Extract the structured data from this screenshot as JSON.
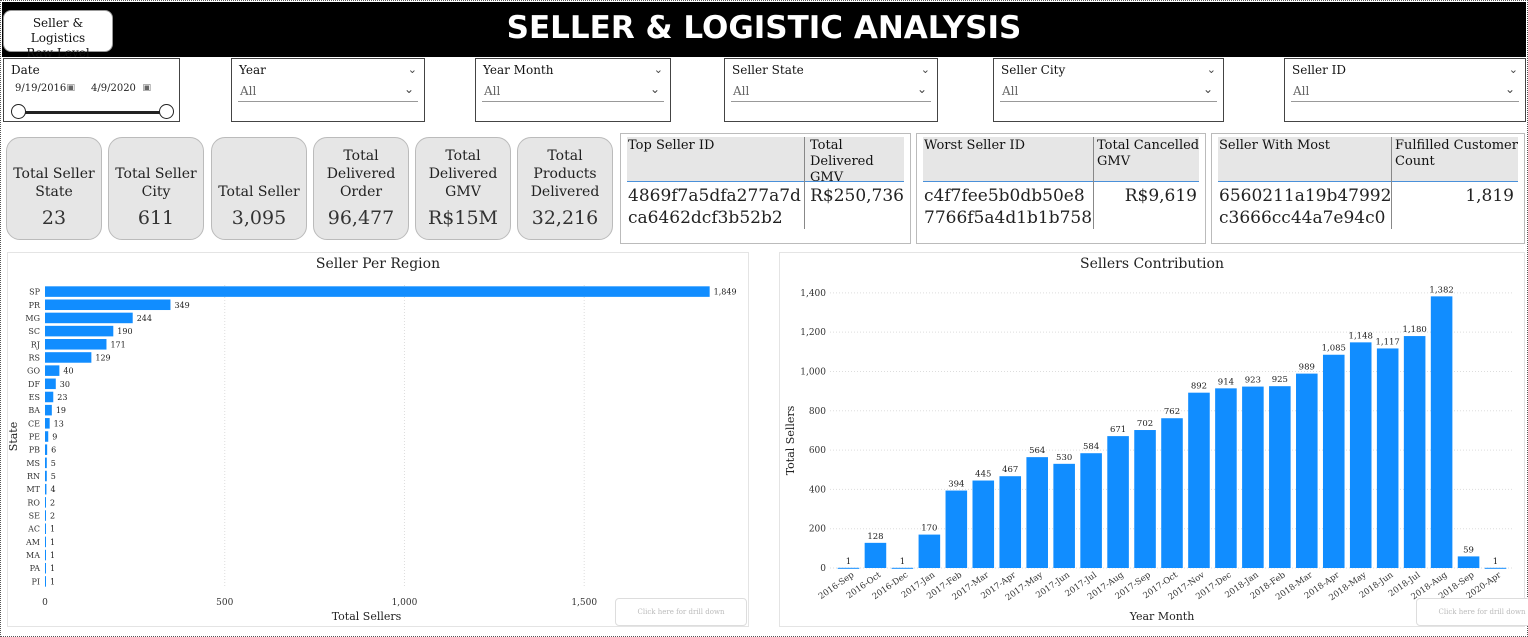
{
  "header": {
    "title": "SELLER & LOGISTIC ANALYSIS",
    "nav_button_line1": "Seller & Logistics",
    "nav_button_line2": "Raw Level"
  },
  "filters": {
    "date": {
      "label": "Date",
      "start": "9/19/2016",
      "end": "4/9/2020"
    },
    "year": {
      "label": "Year",
      "value": "All"
    },
    "year_month": {
      "label": "Year Month",
      "value": "All"
    },
    "seller_state": {
      "label": "Seller State",
      "value": "All"
    },
    "seller_city": {
      "label": "Seller City",
      "value": "All"
    },
    "seller_id": {
      "label": "Seller ID",
      "value": "All"
    }
  },
  "kpis": [
    {
      "label": "Total Seller State",
      "value": "23"
    },
    {
      "label": "Total Seller City",
      "value": "611"
    },
    {
      "label": "Total Seller",
      "value": "3,095"
    },
    {
      "label": "Total Delivered Order",
      "value": "96,477"
    },
    {
      "label": "Total Delivered GMV",
      "value": "R$15M"
    },
    {
      "label": "Total Products Delivered",
      "value": "32,216"
    }
  ],
  "tables": {
    "top_seller": {
      "col1": "Top Seller ID",
      "col2": "Total Delivered GMV",
      "id_line1": "4869f7a5dfa277a7d",
      "id_line2": "ca6462dcf3b52b2",
      "value": "R$250,736"
    },
    "worst_seller": {
      "col1": "Worst Seller ID",
      "col2": "Total Cancelled GMV",
      "id_line1": "c4f7fee5b0db50e8",
      "id_line2": "7766f5a4d1b1b758",
      "value": "R$9,619"
    },
    "most_customers": {
      "col1": "Seller With Most",
      "col2": "Fulfilled Customer Count",
      "id_line1": "6560211a19b47992",
      "id_line2": "c3666cc44a7e94c0",
      "value": "1,819"
    }
  },
  "drill_label": "Click here for drill down",
  "colors": {
    "bar": "#118DFF",
    "banner": "#000000"
  },
  "chart_data": [
    {
      "type": "bar",
      "orientation": "horizontal",
      "title": "Seller Per Region",
      "xlabel": "Total Sellers",
      "ylabel": "State",
      "xlim": [
        0,
        1900
      ],
      "xticks": [
        0,
        500,
        1000,
        1500
      ],
      "xtick_labels": [
        "0",
        "500",
        "1,000",
        "1,500"
      ],
      "grid": true,
      "categories": [
        "SP",
        "PR",
        "MG",
        "SC",
        "RJ",
        "RS",
        "GO",
        "DF",
        "ES",
        "BA",
        "CE",
        "PE",
        "PB",
        "MS",
        "RN",
        "MT",
        "RO",
        "SE",
        "AC",
        "AM",
        "MA",
        "PA",
        "PI"
      ],
      "values": [
        1849,
        349,
        244,
        190,
        171,
        129,
        40,
        30,
        23,
        19,
        13,
        9,
        6,
        5,
        5,
        4,
        2,
        2,
        1,
        1,
        1,
        1,
        1
      ],
      "value_labels": [
        "1,849",
        "349",
        "244",
        "190",
        "171",
        "129",
        "40",
        "30",
        "23",
        "19",
        "13",
        "9",
        "6",
        "5",
        "5",
        "4",
        "2",
        "2",
        "1",
        "1",
        "1",
        "1",
        "1"
      ]
    },
    {
      "type": "bar",
      "title": "Sellers Contribution",
      "xlabel": "Year Month",
      "ylabel": "Total Sellers",
      "ylim": [
        0,
        1450
      ],
      "yticks": [
        0,
        200,
        400,
        600,
        800,
        1000,
        1200,
        1400
      ],
      "ytick_labels": [
        "0",
        "200",
        "400",
        "600",
        "800",
        "1,000",
        "1,200",
        "1,400"
      ],
      "grid": true,
      "categories": [
        "2016-Sep",
        "2016-Oct",
        "2016-Dec",
        "2017-Jan",
        "2017-Feb",
        "2017-Mar",
        "2017-Apr",
        "2017-May",
        "2017-Jun",
        "2017-Jul",
        "2017-Aug",
        "2017-Sep",
        "2017-Oct",
        "2017-Nov",
        "2017-Dec",
        "2018-Jan",
        "2018-Feb",
        "2018-Mar",
        "2018-Apr",
        "2018-May",
        "2018-Jun",
        "2018-Jul",
        "2018-Aug",
        "2018-Sep",
        "2020-Apr"
      ],
      "values": [
        1,
        128,
        1,
        170,
        394,
        445,
        467,
        564,
        530,
        584,
        671,
        702,
        762,
        892,
        914,
        923,
        925,
        989,
        1085,
        1148,
        1117,
        1180,
        1382,
        59,
        1
      ],
      "value_labels": [
        "1",
        "128",
        "1",
        "170",
        "394",
        "445",
        "467",
        "564",
        "530",
        "584",
        "671",
        "702",
        "762",
        "892",
        "914",
        "923",
        "925",
        "989",
        "1,085",
        "1,148",
        "1,117",
        "1,180",
        "1,382",
        "59",
        "1"
      ]
    }
  ]
}
